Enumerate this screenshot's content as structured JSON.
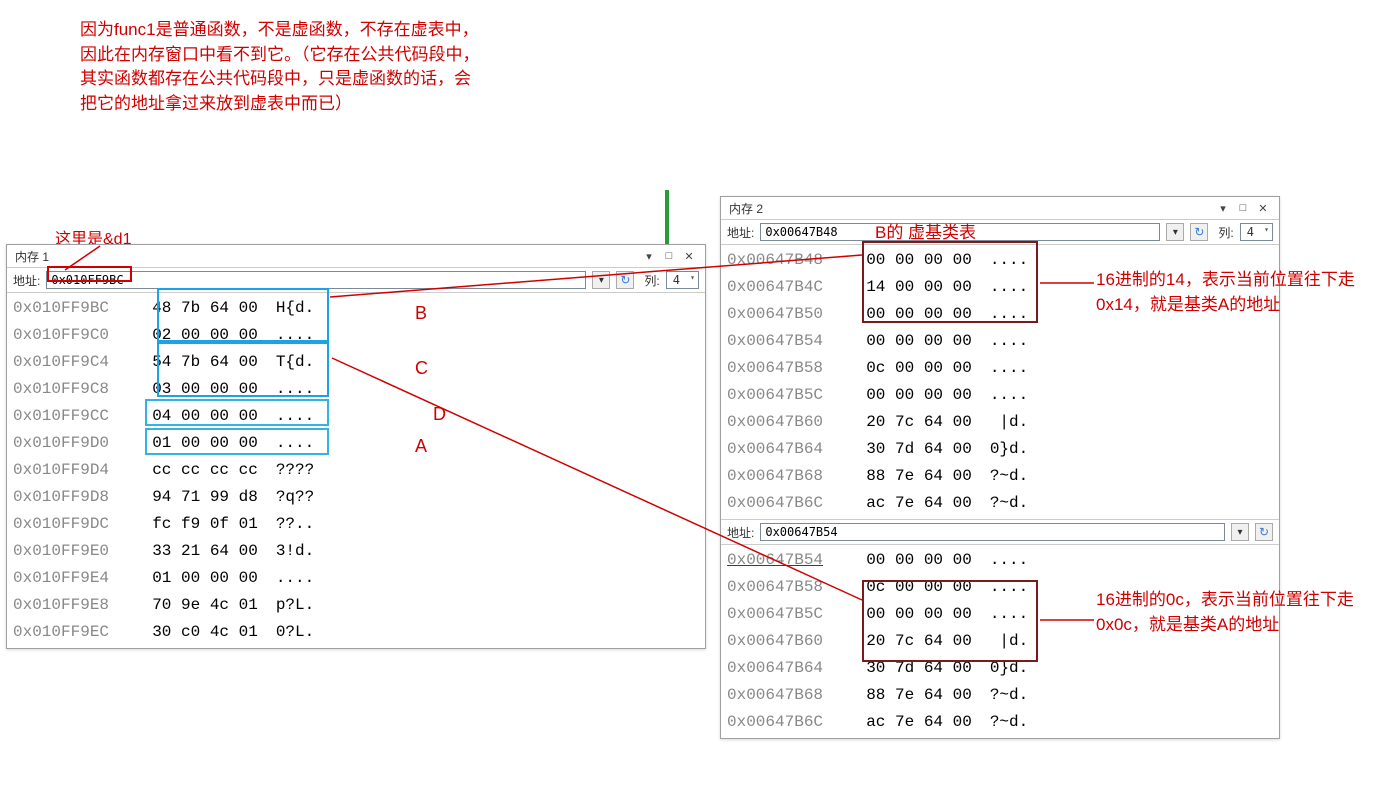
{
  "top_note": "因为func1是普通函数，不是虚函数，不存在虚表中，因此在内存窗口中看不到它。（它存在公共代码段中，其实函数都存在公共代码段中，只是虚函数的话，会把它的地址拿过来放到虚表中而已）",
  "label_d1": "这里是&d1",
  "label_b_vbt": "B的 虚基类表",
  "panel1": {
    "title": "内存 1",
    "addr_label": "地址:",
    "addr_value": "0x010FF9BC",
    "col_label": "列:",
    "col_value": "4",
    "rows": [
      {
        "addr": "0x010FF9BC",
        "hex": "48 7b 64 00",
        "ascii": "H{d."
      },
      {
        "addr": "0x010FF9C0",
        "hex": "02 00 00 00",
        "ascii": "...."
      },
      {
        "addr": "0x010FF9C4",
        "hex": "54 7b 64 00",
        "ascii": "T{d."
      },
      {
        "addr": "0x010FF9C8",
        "hex": "03 00 00 00",
        "ascii": "...."
      },
      {
        "addr": "0x010FF9CC",
        "hex": "04 00 00 00",
        "ascii": "...."
      },
      {
        "addr": "0x010FF9D0",
        "hex": "01 00 00 00",
        "ascii": "...."
      },
      {
        "addr": "0x010FF9D4",
        "hex": "cc cc cc cc",
        "ascii": "????"
      },
      {
        "addr": "0x010FF9D8",
        "hex": "94 71 99 d8",
        "ascii": "?q??"
      },
      {
        "addr": "0x010FF9DC",
        "hex": "fc f9 0f 01",
        "ascii": "??.."
      },
      {
        "addr": "0x010FF9E0",
        "hex": "33 21 64 00",
        "ascii": "3!d."
      },
      {
        "addr": "0x010FF9E4",
        "hex": "01 00 00 00",
        "ascii": "...."
      },
      {
        "addr": "0x010FF9E8",
        "hex": "70 9e 4c 01",
        "ascii": "p?L."
      },
      {
        "addr": "0x010FF9EC",
        "hex": "30 c0 4c 01",
        "ascii": "0?L."
      }
    ]
  },
  "row_labels": {
    "B": "B",
    "C": "C",
    "D": "D",
    "A": "A"
  },
  "panel2": {
    "title": "内存 2",
    "addr_label": "地址:",
    "addr_value": "0x00647B48",
    "col_label": "列:",
    "col_value": "4",
    "rows": [
      {
        "addr": "0x00647B48",
        "hex": "00 00 00 00",
        "ascii": "...."
      },
      {
        "addr": "0x00647B4C",
        "hex": "14 00 00 00",
        "ascii": "...."
      },
      {
        "addr": "0x00647B50",
        "hex": "00 00 00 00",
        "ascii": "...."
      },
      {
        "addr": "0x00647B54",
        "hex": "00 00 00 00",
        "ascii": "...."
      },
      {
        "addr": "0x00647B58",
        "hex": "0c 00 00 00",
        "ascii": "...."
      },
      {
        "addr": "0x00647B5C",
        "hex": "00 00 00 00",
        "ascii": "...."
      },
      {
        "addr": "0x00647B60",
        "hex": "20 7c 64 00",
        "ascii": " |d."
      },
      {
        "addr": "0x00647B64",
        "hex": "30 7d 64 00",
        "ascii": "0}d."
      },
      {
        "addr": "0x00647B68",
        "hex": "88 7e 64 00",
        "ascii": "?~d."
      },
      {
        "addr": "0x00647B6C",
        "hex": "ac 7e 64 00",
        "ascii": "?~d."
      }
    ]
  },
  "panel3": {
    "addr_label": "地址:",
    "addr_value": "0x00647B54",
    "rows": [
      {
        "addr": "0x00647B54",
        "hex": "00 00 00 00",
        "ascii": "...."
      },
      {
        "addr": "0x00647B58",
        "hex": "0c 00 00 00",
        "ascii": "...."
      },
      {
        "addr": "0x00647B5C",
        "hex": "00 00 00 00",
        "ascii": "...."
      },
      {
        "addr": "0x00647B60",
        "hex": "20 7c 64 00",
        "ascii": " |d."
      },
      {
        "addr": "0x00647B64",
        "hex": "30 7d 64 00",
        "ascii": "0}d."
      },
      {
        "addr": "0x00647B68",
        "hex": "88 7e 64 00",
        "ascii": "?~d."
      },
      {
        "addr": "0x00647B6C",
        "hex": "ac 7e 64 00",
        "ascii": "?~d."
      }
    ]
  },
  "note14": "16进制的14，表示当前位置往下走0x14，就是基类A的地址",
  "note0c": "16进制的0c，表示当前位置往下走0x0c，就是基类A的地址"
}
